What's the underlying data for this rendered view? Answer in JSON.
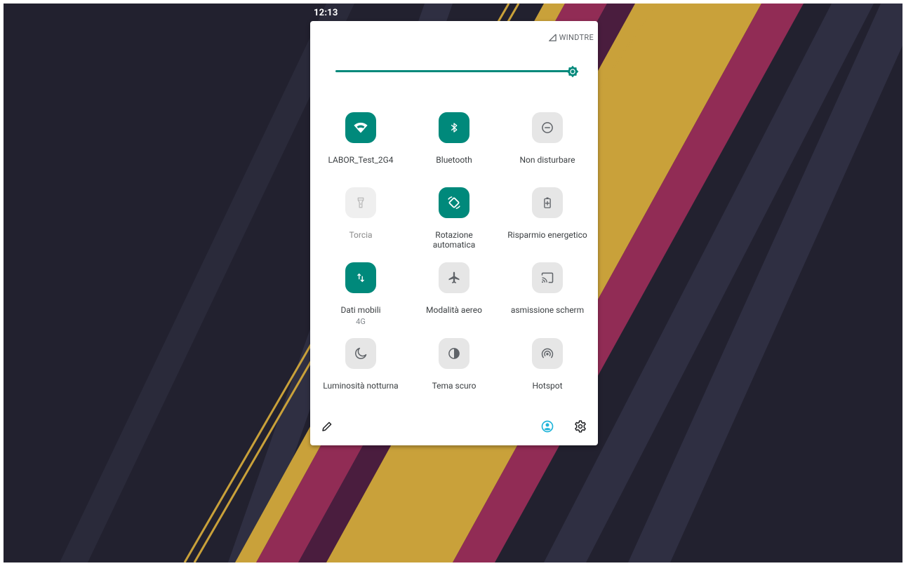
{
  "status_bar": {
    "time": "12:13"
  },
  "quick_settings": {
    "carrier": "WINDTRE",
    "brightness_level": 1.0,
    "colors": {
      "active": "#00897b",
      "inactive": "#e6e6e6",
      "accent_user": "#1fb4d9"
    },
    "tiles": [
      {
        "label": "LABOR_Test_2G4",
        "state": "on",
        "icon": "wifi-icon"
      },
      {
        "label": "Bluetooth",
        "state": "on",
        "icon": "bluetooth-icon"
      },
      {
        "label": "Non disturbare",
        "state": "off",
        "icon": "do-not-disturb-icon"
      },
      {
        "label": "Torcia",
        "state": "disabled",
        "icon": "flashlight-icon"
      },
      {
        "label": "Rotazione automatica",
        "state": "on",
        "icon": "auto-rotate-icon"
      },
      {
        "label": "Risparmio energetico",
        "state": "off",
        "icon": "battery-saver-icon"
      },
      {
        "label": "Dati mobili",
        "sub": "4G",
        "state": "on",
        "icon": "mobile-data-icon"
      },
      {
        "label": "Modalità aereo",
        "state": "off",
        "icon": "airplane-icon"
      },
      {
        "label": "asmissione scherm",
        "state": "off",
        "icon": "cast-icon"
      },
      {
        "label": "Luminosità notturna",
        "state": "off",
        "icon": "night-light-icon"
      },
      {
        "label": "Tema scuro",
        "state": "off",
        "icon": "dark-theme-icon"
      },
      {
        "label": "Hotspot",
        "state": "off",
        "icon": "hotspot-icon"
      }
    ]
  }
}
